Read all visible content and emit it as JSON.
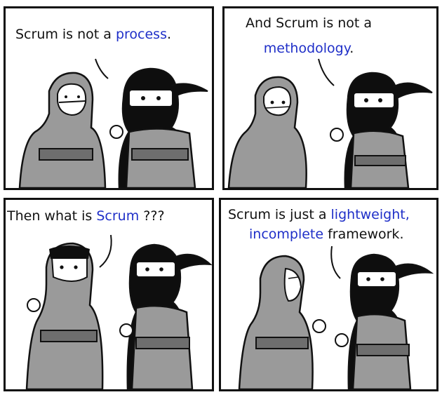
{
  "panels": [
    {
      "parts": [
        "Scrum is not a ",
        "process",
        "."
      ]
    },
    {
      "line1": "And Scrum is not a",
      "line2_hl": "methodology",
      "line2_end": "."
    },
    {
      "parts": [
        "Then what is ",
        "Scrum",
        " ???"
      ]
    },
    {
      "line1_a": "Scrum is just a ",
      "line1_hl": "lightweight,",
      "line2_hl": "incomplete",
      "line2_end": " framework."
    }
  ],
  "colors": {
    "highlight": "#1f2fc8",
    "robe": "#9a9a9a",
    "mask": "#0e0e0e",
    "outline": "#111111"
  }
}
